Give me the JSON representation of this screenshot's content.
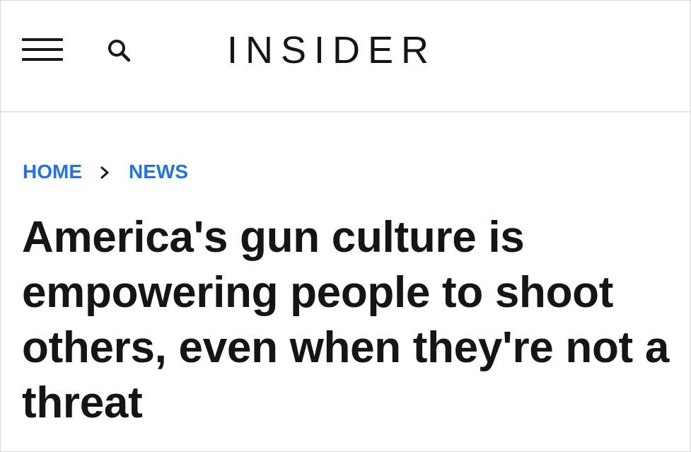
{
  "header": {
    "logo": "INSIDER",
    "menu_icon": "hamburger-menu-icon",
    "search_icon": "search-icon"
  },
  "breadcrumb": {
    "items": [
      {
        "label": "HOME"
      },
      {
        "label": "NEWS"
      }
    ],
    "separator_icon": "chevron-right-icon"
  },
  "article": {
    "headline": "America's gun culture is empowering people to shoot others, even when they're not a threat"
  },
  "colors": {
    "link_blue": "#2173e6",
    "text_dark": "#151515",
    "divider": "#e2e2e2"
  }
}
